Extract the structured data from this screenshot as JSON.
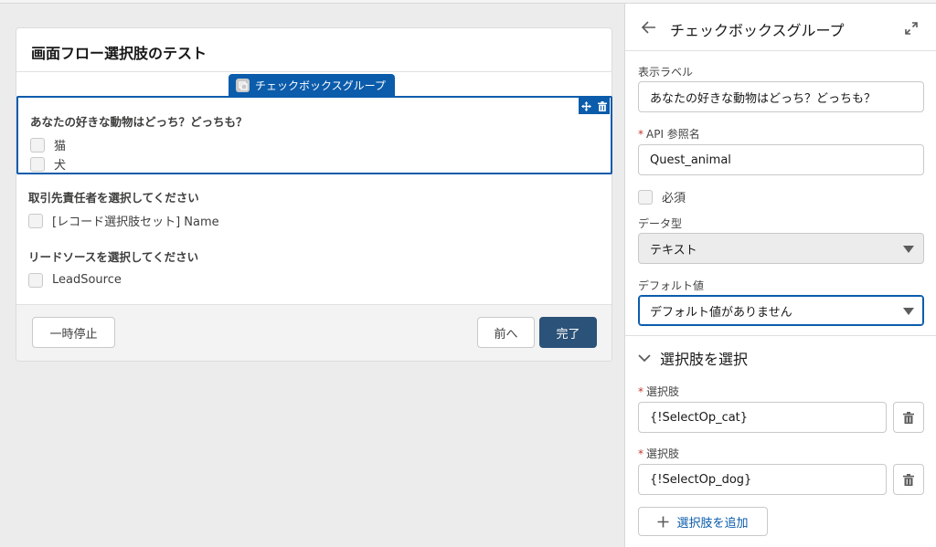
{
  "canvas": {
    "screen_title": "画面フロー選択肢のテスト",
    "selected_component_tag": "チェックボックスグループ",
    "checkbox_group": {
      "label": "あなたの好きな動物はどっち？どっちも？",
      "options": [
        "猫",
        "犬"
      ]
    },
    "contact_group": {
      "label": "取引先責任者を選択してください",
      "options": [
        "[レコード選択肢セット] Name"
      ]
    },
    "lead_group": {
      "label": "リードソースを選択してください",
      "options": [
        "LeadSource"
      ]
    },
    "footer": {
      "pause_label": "一時停止",
      "prev_label": "前へ",
      "finish_label": "完了"
    }
  },
  "panel": {
    "title": "チェックボックスグループ",
    "display_label": {
      "label": "表示ラベル",
      "value": "あなたの好きな動物はどっち？どっちも？"
    },
    "api_name": {
      "label": "API 参照名",
      "value": "Quest_animal"
    },
    "required_label": "必須",
    "data_type": {
      "label": "データ型",
      "value": "テキスト"
    },
    "default_value": {
      "label": "デフォルト値",
      "value": "デフォルト値がありません"
    },
    "choices_section": {
      "title": "選択肢を選択",
      "choice_label": "選択肢",
      "choices": [
        "{!SelectOp_cat}",
        "{!SelectOp_dog}"
      ],
      "add_label": "選択肢を追加"
    }
  },
  "colors": {
    "brand_blue": "#0b5cab",
    "finish_button": "#2b5278",
    "required_star": "#c23934"
  }
}
